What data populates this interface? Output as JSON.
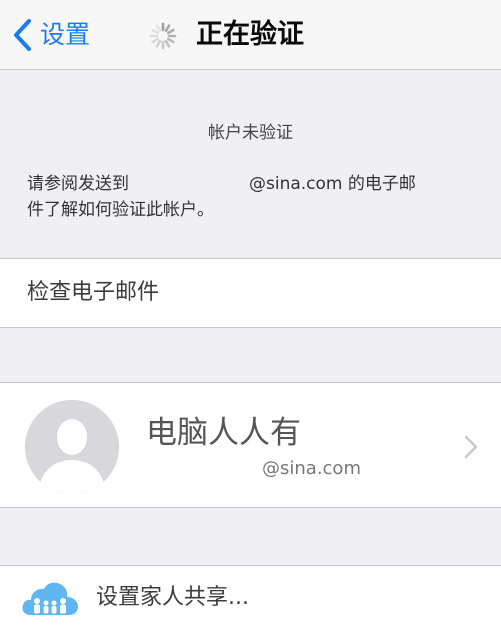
{
  "navbar": {
    "back_label": "设置",
    "title": "正在验证"
  },
  "info": {
    "heading": "帐户未验证",
    "body_prefix": "请参阅发送到",
    "body_email": "@sina.com",
    "body_suffix": " 的电子邮",
    "body_line2": "件了解如何验证此帐户。"
  },
  "check_email": {
    "label": "检查电子邮件"
  },
  "account": {
    "name": "电脑人人有",
    "email": "@sina.com"
  },
  "family": {
    "label": "设置家人共享..."
  },
  "colors": {
    "accent": "#1a7cf5",
    "background": "#efeff4",
    "icloud_blue": "#5fb6f0"
  },
  "icons": [
    "chevron-left-icon",
    "loading-spinner-icon",
    "avatar-placeholder-icon",
    "chevron-right-icon",
    "family-sharing-icon"
  ]
}
